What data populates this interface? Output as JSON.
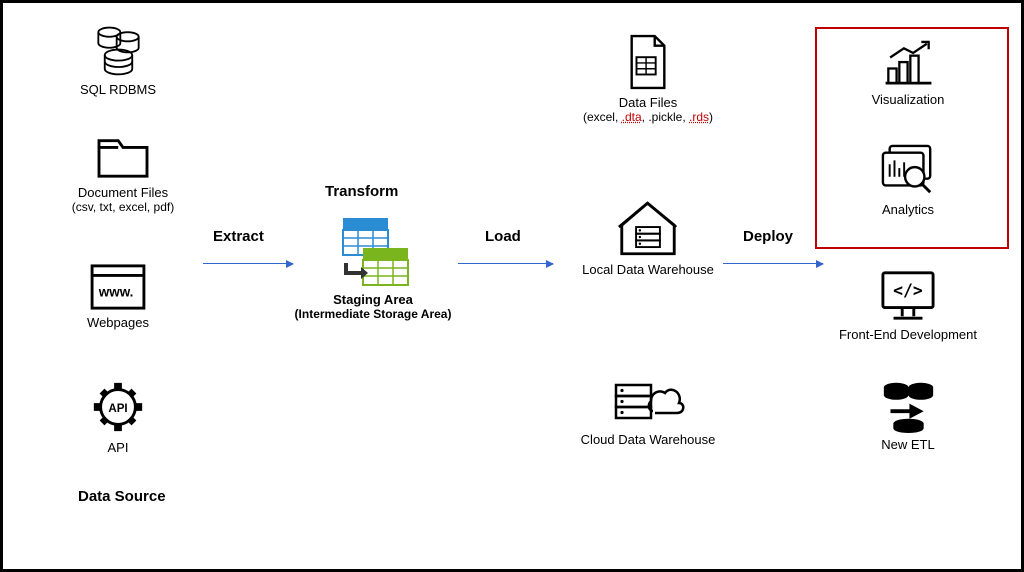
{
  "sources": {
    "sql": {
      "label": "SQL RDBMS"
    },
    "doc": {
      "label": "Document Files",
      "sublabel": "(csv, txt, excel, pdf)"
    },
    "web": {
      "label": "Webpages"
    },
    "api": {
      "label": "API"
    },
    "section": "Data Source"
  },
  "arrows": {
    "extract": "Extract",
    "load": "Load",
    "deploy": "Deploy"
  },
  "staging": {
    "transform": "Transform",
    "title": "Staging Area",
    "subtitle": "(Intermediate Storage Area)"
  },
  "load": {
    "datafiles": {
      "label": "Data Files",
      "sublabel_pre": "(excel, ",
      "sublabel_dta": ".dta",
      "sublabel_mid": ", .pickle, ",
      "sublabel_rds": ".rds",
      "sublabel_end": ")"
    },
    "local": {
      "label": "Local Data Warehouse"
    },
    "cloud": {
      "label": "Cloud Data Warehouse"
    }
  },
  "deploy": {
    "viz": {
      "label": "Visualization"
    },
    "analytics": {
      "label": "Analytics"
    },
    "frontend": {
      "label": "Front-End Development"
    },
    "etl": {
      "label": "New ETL"
    }
  }
}
